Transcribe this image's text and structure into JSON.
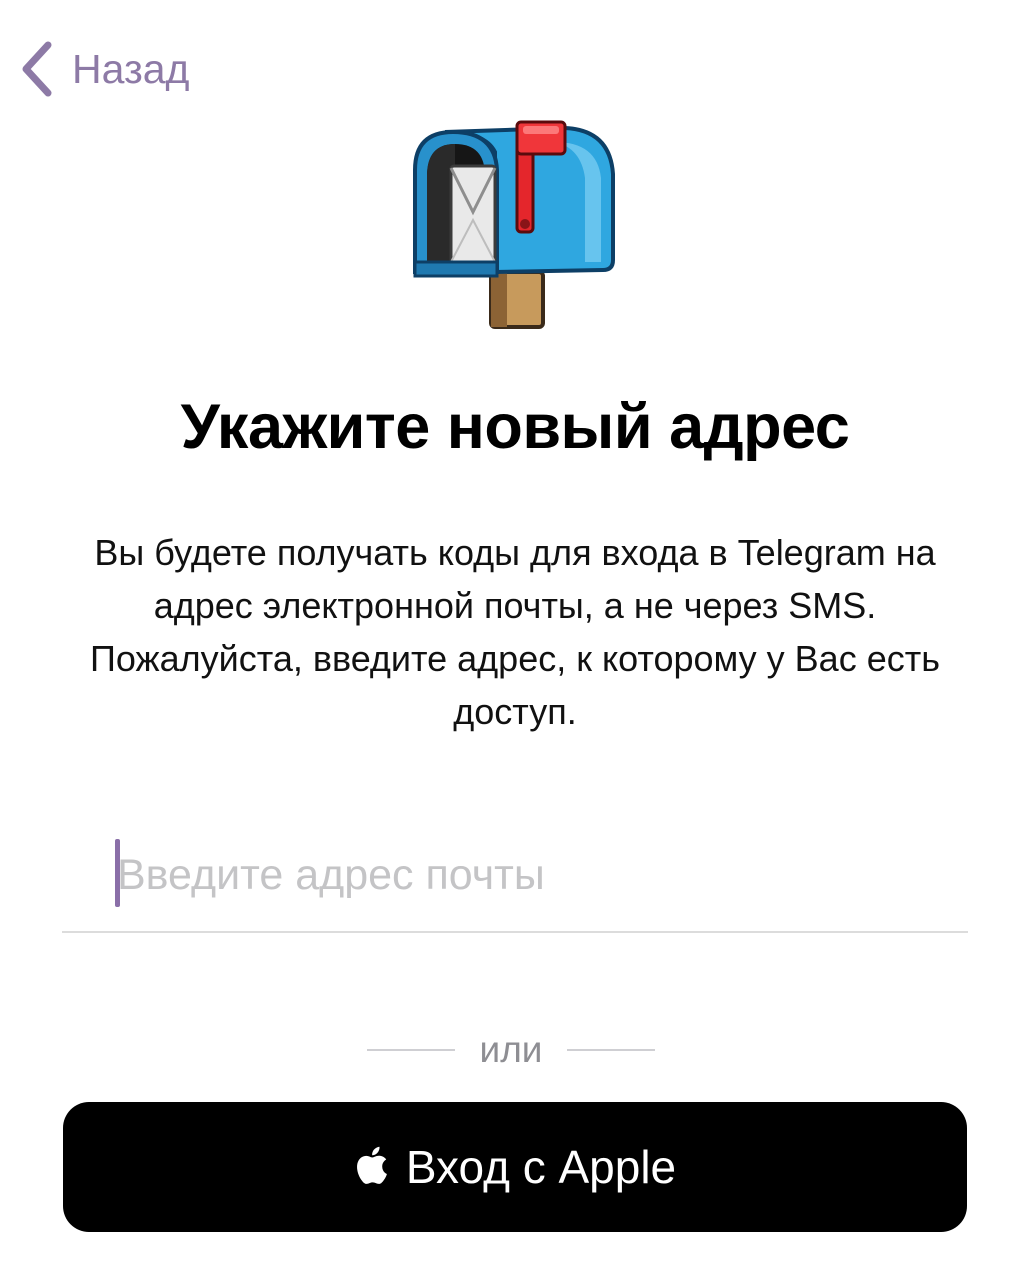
{
  "nav": {
    "back_label": "Назад",
    "back_icon": "chevron-left-icon",
    "accent_color": "#8d7aa6"
  },
  "illustration": {
    "icon": "mailbox-with-flag-icon"
  },
  "main": {
    "title": "Укажите новый адрес",
    "description": "Вы будете получать коды для входа в Telegram на адрес электронной почты, а не через SMS. Пожалуйста, введите адрес, к которому у Вас есть доступ."
  },
  "email_input": {
    "value": "",
    "placeholder": "Введите адрес почты",
    "caret_color": "#8a6fa8"
  },
  "separator": {
    "label": "или"
  },
  "apple_signin": {
    "label": "Вход с Apple",
    "icon": "apple-logo-icon",
    "background": "#000000"
  }
}
